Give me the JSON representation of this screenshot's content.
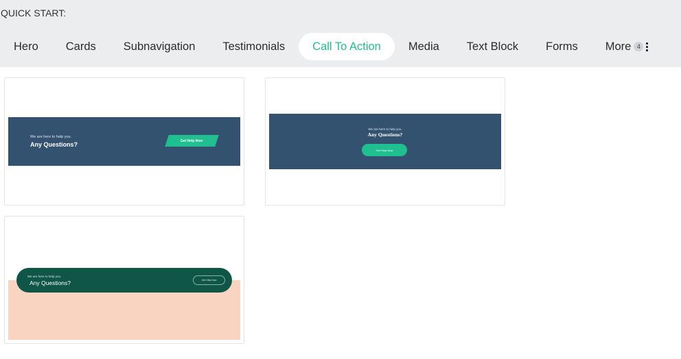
{
  "quick_start": {
    "label": "QUICK START:"
  },
  "tabs": [
    {
      "label": "Hero",
      "active": false
    },
    {
      "label": "Cards",
      "active": false
    },
    {
      "label": "Subnavigation",
      "active": false
    },
    {
      "label": "Testimonials",
      "active": false
    },
    {
      "label": "Call To Action",
      "active": true
    },
    {
      "label": "Media",
      "active": false
    },
    {
      "label": "Text Block",
      "active": false
    },
    {
      "label": "Forms",
      "active": false
    }
  ],
  "more": {
    "label": "More",
    "count": "4",
    "icon": "kebab-vertical-icon"
  },
  "colors": {
    "accent": "#1fbf8f",
    "navy": "#33526f",
    "dark_green": "#0f5548",
    "peach": "#f9d4c1"
  },
  "cards": [
    {
      "small_text": "We are here to help you.",
      "heading": "Any Questions?",
      "button": "Get Help Now"
    },
    {
      "small_text": "We are here to help you.",
      "heading": "Any Questions?",
      "button": "Get Help Now"
    },
    {
      "small_text": "We are here to help you.",
      "heading": "Any Questions?",
      "button": "Get Help Now"
    }
  ]
}
